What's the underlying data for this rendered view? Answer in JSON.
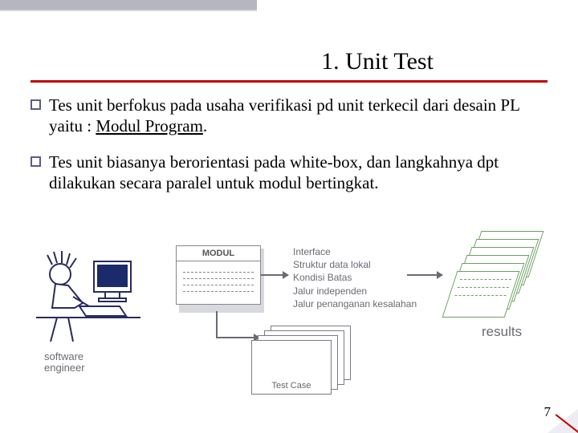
{
  "title": "1. Unit Test",
  "bullets": [
    {
      "pre": "Tes unit berfokus pada usaha verifikasi pd  unit terkecil dari desain PL yaitu : ",
      "underlined": "Modul Program",
      "post": "."
    },
    {
      "pre": "Tes unit biasanya berorientasi pada white-box, dan langkahnya dpt dilakukan secara paralel untuk modul bertingkat.",
      "underlined": "",
      "post": ""
    }
  ],
  "diagram": {
    "engineer_label_l1": "software",
    "engineer_label_l2": "engineer",
    "module_header": "MODUL",
    "interface_lines": [
      "Interface",
      "Struktur data lokal",
      "Kondisi Batas",
      "Jalur independen",
      "Jalur penanganan kesalahan"
    ],
    "results_label": "results",
    "testcase_label": "Test Case"
  },
  "page_number": "7"
}
